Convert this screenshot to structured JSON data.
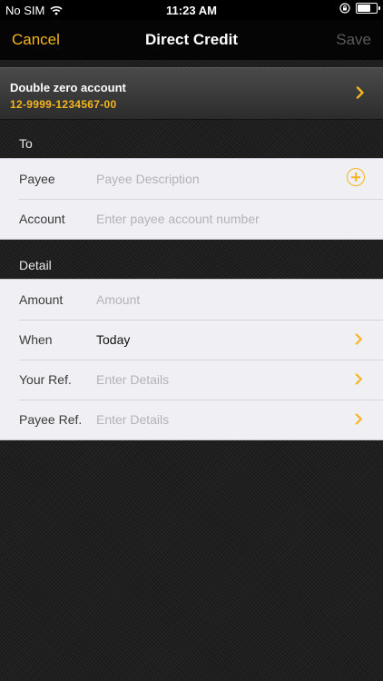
{
  "status_bar": {
    "carrier": "No SIM",
    "time": "11:23 AM"
  },
  "nav": {
    "cancel_label": "Cancel",
    "title": "Direct Credit",
    "save_label": "Save"
  },
  "account": {
    "name": "Double zero account",
    "number": "12-9999-1234567-00"
  },
  "to_section": {
    "header": "To",
    "rows": [
      {
        "label": "Payee",
        "placeholder": "Payee Description"
      },
      {
        "label": "Account",
        "placeholder": "Enter payee account number"
      }
    ]
  },
  "detail_section": {
    "header": "Detail",
    "rows": [
      {
        "label": "Amount",
        "placeholder": "Amount"
      },
      {
        "label": "When",
        "value": "Today"
      },
      {
        "label": "Your Ref.",
        "placeholder": "Enter Details"
      },
      {
        "label": "Payee Ref.",
        "placeholder": "Enter Details"
      }
    ]
  },
  "colors": {
    "accent": "#f5b51e",
    "disabled": "#5a5a5a",
    "row_bg": "#efeff4"
  },
  "icons": [
    "wifi-icon",
    "orientation-lock-icon",
    "battery-icon",
    "chevron-right-icon",
    "add-circle-icon"
  ]
}
